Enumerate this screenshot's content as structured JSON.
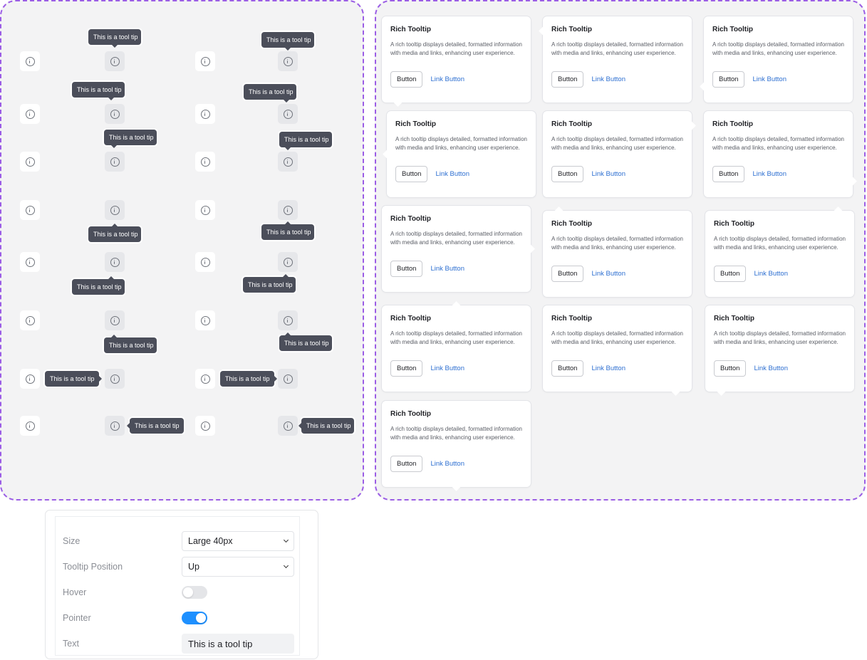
{
  "tooltip_demo": {
    "tooltip_text": "This is a tool tip"
  },
  "rich_tooltip": {
    "title": "Rich Tooltip",
    "body": "A rich tooltip displays detailed, formatted information with media and links, enhancing user experience.",
    "button_label": "Button",
    "link_label": "Link Button"
  },
  "settings": {
    "size": {
      "label": "Size",
      "value": "Large 40px"
    },
    "position": {
      "label": "Tooltip Position",
      "value": "Up"
    },
    "hover": {
      "label": "Hover",
      "enabled": false
    },
    "pointer": {
      "label": "Pointer",
      "enabled": true
    },
    "text": {
      "label": "Text",
      "value": "This is a tool tip"
    }
  },
  "colors": {
    "accent_border": "#9b5de5",
    "tooltip_bg": "#4b4e5a",
    "toggle_on": "#1e90ff",
    "link": "#2d6fd1"
  },
  "icons": [
    "info-icon",
    "chevron-down-icon"
  ]
}
